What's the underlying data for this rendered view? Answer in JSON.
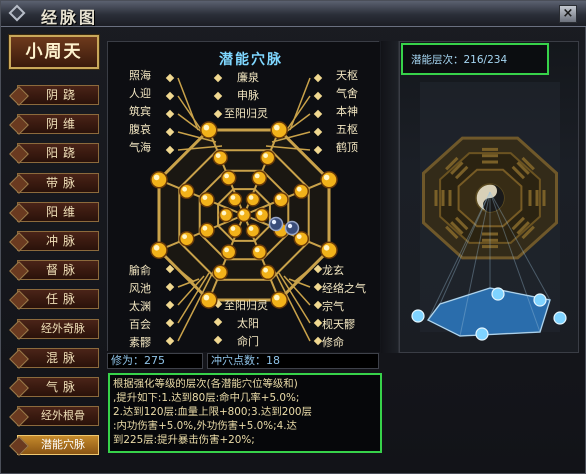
{
  "window": {
    "title": "经脉图",
    "close_label": "×"
  },
  "nav": {
    "header": "小周天",
    "items": [
      {
        "label": "阴跷",
        "active": false
      },
      {
        "label": "阴维",
        "active": false
      },
      {
        "label": "阳跷",
        "active": false
      },
      {
        "label": "带脉",
        "active": false
      },
      {
        "label": "阳维",
        "active": false
      },
      {
        "label": "冲脉",
        "active": false
      },
      {
        "label": "督脉",
        "active": false
      },
      {
        "label": "任脉",
        "active": false
      },
      {
        "label": "经外奇脉",
        "active": false
      },
      {
        "label": "混脉",
        "active": false
      },
      {
        "label": "气脉",
        "active": false
      },
      {
        "label": "经外根骨",
        "active": false
      },
      {
        "label": "潜能穴脉",
        "active": true
      }
    ]
  },
  "meridian": {
    "title": "潜能穴脉",
    "left_top": [
      "照海",
      "人迎",
      "筑宾",
      "腹哀",
      "气海"
    ],
    "left_bottom": [
      "腧俞",
      "风池",
      "太渊",
      "百会",
      "素髎"
    ],
    "center_top": [
      "廉泉",
      "申脉",
      "至阳归灵"
    ],
    "center_bottom": [
      "至阳归灵",
      "太阳",
      "命门"
    ],
    "right_top": [
      "天枢",
      "气舍",
      "本神",
      "五枢",
      "鹤顶"
    ],
    "right_bottom": [
      "龙玄",
      "经络之气",
      "宗气",
      "枧天髎",
      "修命"
    ]
  },
  "stats": {
    "cultivation": "修为：275",
    "breakthrough": "冲穴点数：18"
  },
  "description": [
    "根据强化等级的层次(各潜能穴位等级和)",
    ",提升如下:1.达到80层:命中几率+5.0%;",
    "2.达到120层:血量上限+800;3.达到200层",
    ":内功伤害+5.0%,外功伤害+5.0%;4.达",
    "到225层:提升暴击伤害+20%;"
  ],
  "potential": {
    "label": "潜能层次：216/234",
    "current": 216,
    "max": 234
  },
  "colors": {
    "highlight_box": "#37d24a",
    "node_gold": "#f2b21a",
    "node_active": "#3a4d7a",
    "line_gold": "#c9a24a",
    "platform_blue": "#2e86d8"
  }
}
